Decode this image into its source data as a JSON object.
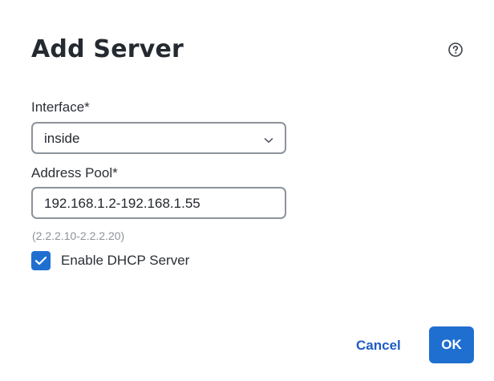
{
  "dialog": {
    "title": "Add Server",
    "help_icon": "question-circle-icon"
  },
  "form": {
    "interface": {
      "label": "Interface*",
      "value": "inside"
    },
    "address_pool": {
      "label": "Address Pool*",
      "value": "192.168.1.2-192.168.1.55",
      "hint": "(2.2.2.10-2.2.2.20)"
    },
    "enable_dhcp": {
      "label": "Enable DHCP Server",
      "checked": true
    }
  },
  "actions": {
    "cancel_label": "Cancel",
    "ok_label": "OK"
  },
  "colors": {
    "accent": "#1f6fd0",
    "link": "#1f5cc4",
    "hint": "#8d939b"
  }
}
